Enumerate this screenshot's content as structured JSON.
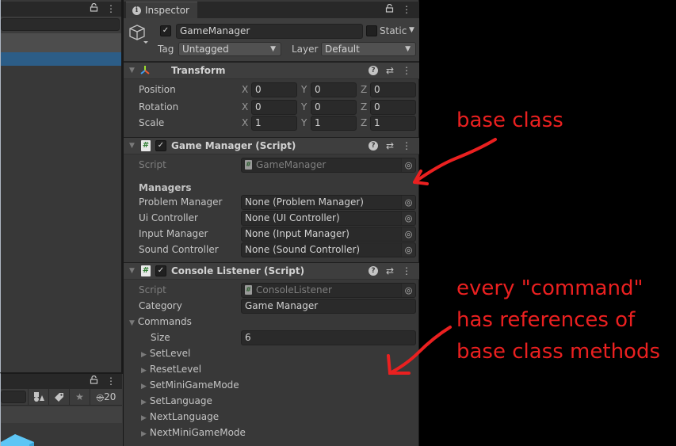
{
  "left_panel_top": {
    "icons": [
      "lock-icon",
      "more-icon"
    ]
  },
  "left_panel_bottom": {
    "icons": [
      "lock-icon",
      "more-icon"
    ],
    "toolbar": {
      "hidden_count": "20"
    }
  },
  "inspector": {
    "tab_label": "Inspector",
    "gameobject": {
      "active": true,
      "name": "GameManager",
      "static_label": "Static",
      "static": false,
      "tag_label": "Tag",
      "tag_value": "Untagged",
      "layer_label": "Layer",
      "layer_value": "Default"
    },
    "transform": {
      "title": "Transform",
      "rows": [
        {
          "label": "Position",
          "x": "0",
          "y": "0",
          "z": "0"
        },
        {
          "label": "Rotation",
          "x": "0",
          "y": "0",
          "z": "0"
        },
        {
          "label": "Scale",
          "x": "1",
          "y": "1",
          "z": "1"
        }
      ],
      "axis_labels": {
        "x": "X",
        "y": "Y",
        "z": "Z"
      }
    },
    "game_manager": {
      "title": "Game Manager (Script)",
      "enabled": true,
      "script_label": "Script",
      "script_value": "GameManager",
      "section_label": "Managers",
      "fields": [
        {
          "label": "Problem Manager",
          "value": "None (Problem Manager)"
        },
        {
          "label": "Ui Controller",
          "value": "None (UI Controller)"
        },
        {
          "label": "Input Manager",
          "value": "None (Input Manager)"
        },
        {
          "label": "Sound Controller",
          "value": "None (Sound Controller)"
        }
      ]
    },
    "console_listener": {
      "title": "Console Listener (Script)",
      "enabled": true,
      "script_label": "Script",
      "script_value": "ConsoleListener",
      "category_label": "Category",
      "category_value": "Game Manager",
      "commands_label": "Commands",
      "size_label": "Size",
      "size_value": "6",
      "commands": [
        "SetLevel",
        "ResetLevel",
        "SetMiniGameMode",
        "SetLanguage",
        "NextLanguage",
        "NextMiniGameMode"
      ]
    }
  },
  "annotations": {
    "base_class": "base class",
    "commands_note": [
      "every \"command\"",
      "has references of",
      "base class methods"
    ],
    "color": "#ea2020"
  }
}
